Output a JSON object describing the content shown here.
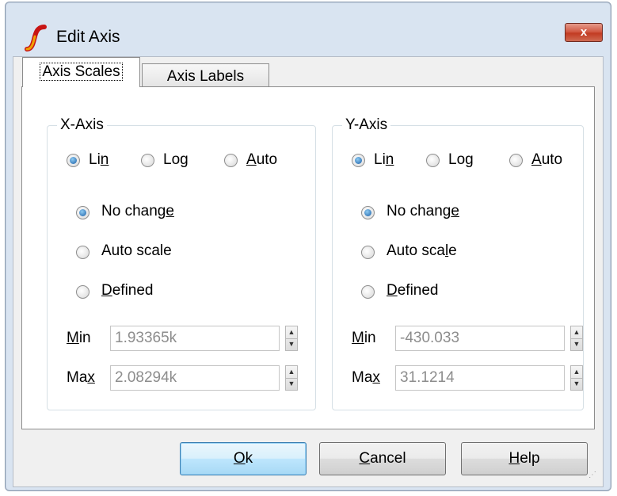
{
  "window": {
    "title": "Edit Axis",
    "close_label": "x",
    "accent_color": "#c23b22",
    "icon": "simetrix-logo-icon"
  },
  "tabs": [
    {
      "label": "Axis Scales",
      "selected": true
    },
    {
      "label": "Axis Labels",
      "selected": false
    }
  ],
  "x_axis": {
    "group_label": "X-Axis",
    "scale_options": [
      {
        "label_pre": "Li",
        "label_u": "n",
        "label_post": "",
        "checked": true
      },
      {
        "label_pre": "Lo",
        "label_u": "g",
        "label_post": "",
        "checked": false
      },
      {
        "label_pre": "",
        "label_u": "A",
        "label_post": "uto",
        "checked": false
      }
    ],
    "mode_options": [
      {
        "label_pre": "No chang",
        "label_u": "e",
        "label_post": "",
        "checked": true
      },
      {
        "label_pre": "Auto scale",
        "label_u": "",
        "label_post": "",
        "checked": false
      },
      {
        "label_pre": "",
        "label_u": "D",
        "label_post": "efined",
        "checked": false
      }
    ],
    "min": {
      "label_pre": "",
      "label_u": "M",
      "label_post": "in",
      "value": "1.93365k"
    },
    "max": {
      "label_pre": "Ma",
      "label_u": "x",
      "label_post": "",
      "value": "2.08294k"
    }
  },
  "y_axis": {
    "group_label": "Y-Axis",
    "scale_options": [
      {
        "label_pre": "Li",
        "label_u": "n",
        "label_post": "",
        "checked": true
      },
      {
        "label_pre": "Lo",
        "label_u": "g",
        "label_post": "",
        "checked": false
      },
      {
        "label_pre": "",
        "label_u": "A",
        "label_post": "uto",
        "checked": false
      }
    ],
    "mode_options": [
      {
        "label_pre": "No chang",
        "label_u": "e",
        "label_post": "",
        "checked": true
      },
      {
        "label_pre": "Auto sca",
        "label_u": "l",
        "label_post": "e",
        "checked": false
      },
      {
        "label_pre": "",
        "label_u": "D",
        "label_post": "efined",
        "checked": false
      }
    ],
    "min": {
      "label_pre": "",
      "label_u": "M",
      "label_post": "in",
      "value": "-430.033"
    },
    "max": {
      "label_pre": "Ma",
      "label_u": "x",
      "label_post": "",
      "value": "31.1214"
    }
  },
  "buttons": {
    "ok": {
      "label_pre": "",
      "label_u": "O",
      "label_post": "k"
    },
    "cancel": {
      "label_pre": "",
      "label_u": "C",
      "label_post": "ancel"
    },
    "help": {
      "label_pre": "",
      "label_u": "H",
      "label_post": "elp"
    }
  }
}
